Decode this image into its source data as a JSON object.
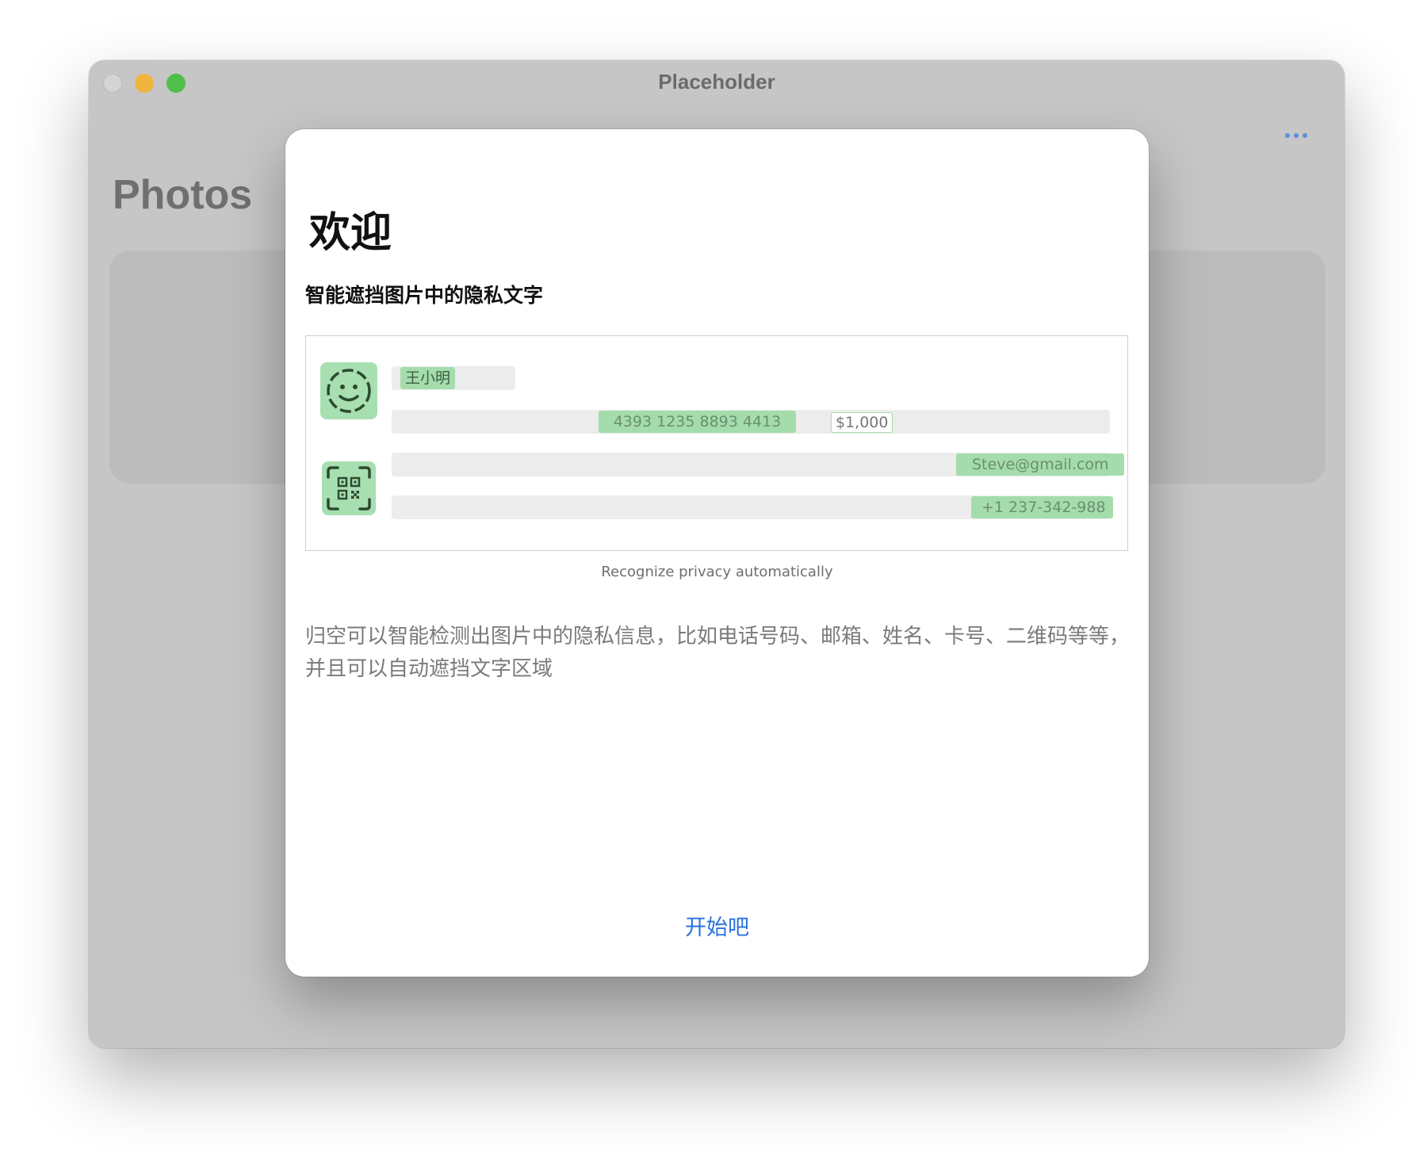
{
  "window": {
    "title": "Placeholder",
    "background_heading": "Photos"
  },
  "toolbar": {
    "more_icon": "ellipsis-icon"
  },
  "modal": {
    "title": "欢迎",
    "subtitle": "智能遮挡图片中的隐私文字",
    "illustration": {
      "icons": [
        "face-id-icon",
        "qr-code-icon"
      ],
      "name_tag": "王小明",
      "card_number": "4393 1235 8893 4413",
      "amount": "$1,000",
      "email": "Steve@gmail.com",
      "phone": "+1 237-342-988"
    },
    "caption": "Recognize privacy automatically",
    "description": "归空可以智能检测出图片中的隐私信息，比如电话号码、邮箱、姓名、卡号、二维码等等，并且可以自动遮挡文字区域",
    "start_label": "开始吧"
  },
  "colors": {
    "accent": "#2a72db",
    "highlight_green": "#a4dcac",
    "close_light": "#d5d5d5",
    "minimize": "#f0b43f",
    "maximize": "#4fbf4a"
  }
}
